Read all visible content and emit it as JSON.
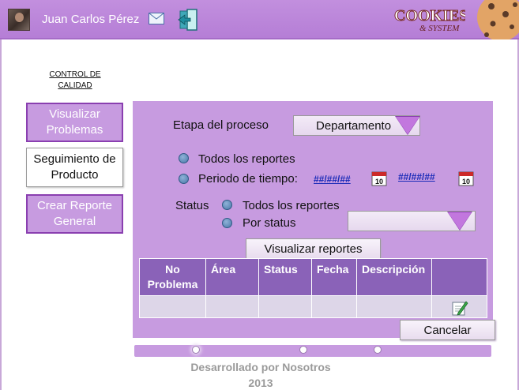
{
  "header": {
    "user_name": "Juan Carlos Pérez",
    "mail_icon": "envelope-icon",
    "exit_icon": "logout-door-icon",
    "brand_line1": "COOKIES",
    "brand_line2": "& SYSTEM"
  },
  "sidebar": {
    "title": "CONTROL DE CALIDAD",
    "items": [
      {
        "label": "Visualizar Problemas"
      },
      {
        "label": "Seguimiento de Producto"
      },
      {
        "label": "Crear Reporte General"
      }
    ]
  },
  "filters": {
    "stage_label": "Etapa del proceso",
    "stage_select": "Departamento",
    "all_reports_label": "Todos los reportes",
    "period_label": "Periodo de tiempo:",
    "date_from": "##/##/##",
    "date_to": "##/##/##",
    "calendar_day": "10",
    "status_label": "Status",
    "status_all_label": "Todos los reportes",
    "status_by_label": "Por status",
    "status_select": ""
  },
  "actions": {
    "view_reports": "Visualizar reportes",
    "cancel": "Cancelar"
  },
  "table": {
    "headers": [
      "No Problema",
      "Área",
      "Status",
      "Fecha",
      "Descripción",
      ""
    ],
    "rows": [
      [
        "",
        "",
        "",
        "",
        "",
        ""
      ]
    ]
  },
  "footer": {
    "line1": "Desarrollado por Nosotros",
    "line2": "2013"
  },
  "colors": {
    "header_purple": "#b57ed6",
    "panel_purple": "#c79be0",
    "table_header": "#8a62b8",
    "link_blue": "#1a2bb8"
  }
}
